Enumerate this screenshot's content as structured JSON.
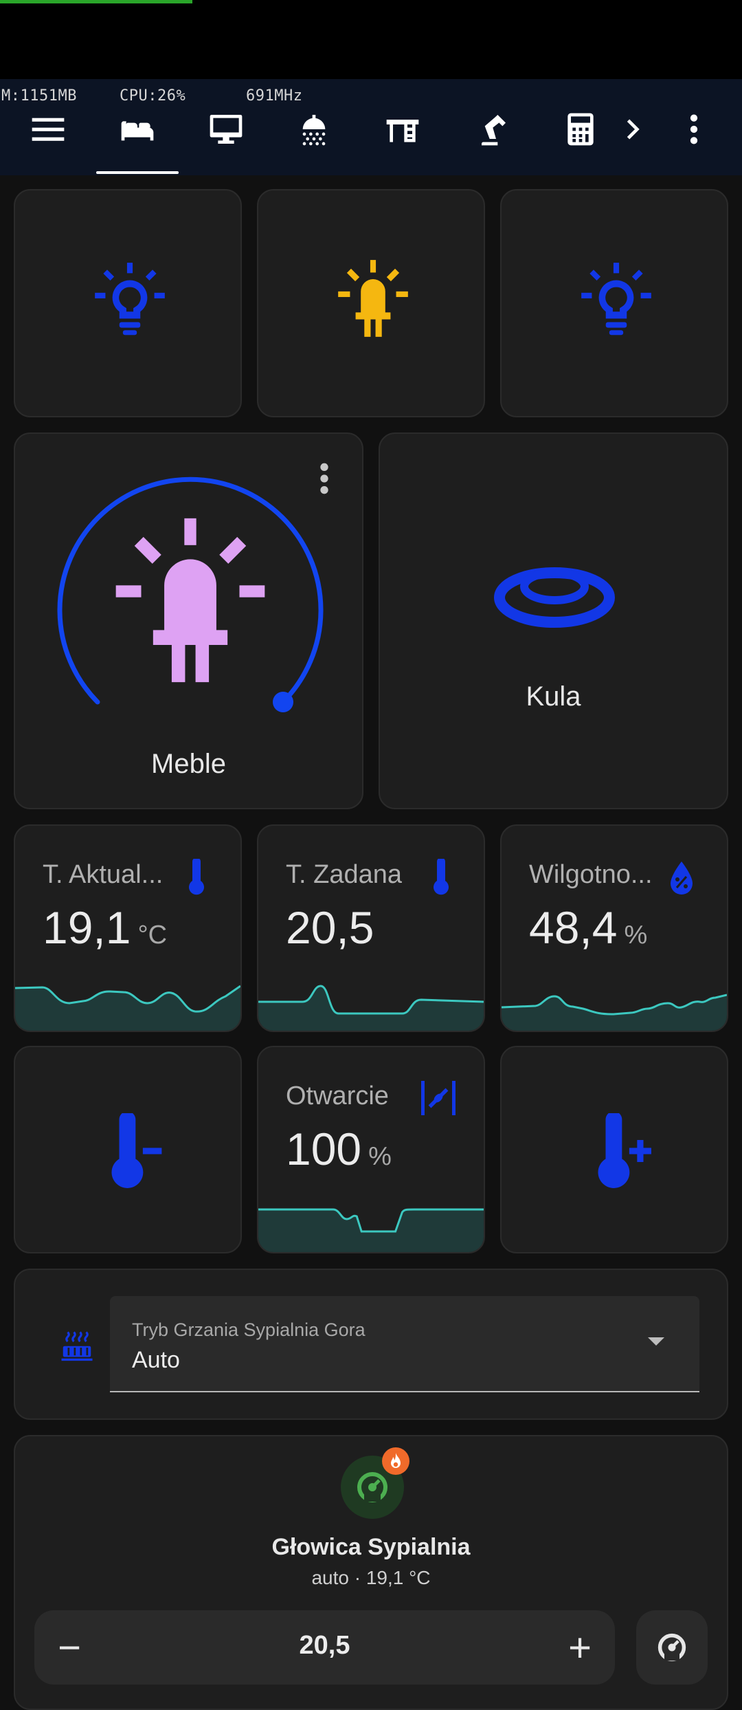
{
  "status": {
    "mem": "M:1151MB",
    "cpu": "CPU:26%",
    "freq": "691MHz"
  },
  "nav": {
    "tabs": [
      {
        "icon": "bed-icon",
        "active": true
      },
      {
        "icon": "monitor-icon",
        "active": false
      },
      {
        "icon": "shower-icon",
        "active": false
      },
      {
        "icon": "desk-icon",
        "active": false
      },
      {
        "icon": "desk-lamp-icon",
        "active": false
      },
      {
        "icon": "calculator-icon",
        "active": false
      }
    ],
    "menu_icon": "menu-icon",
    "more_icon": "chevron-right-icon",
    "overflow_icon": "dots-vertical-icon"
  },
  "lights": [
    {
      "icon": "lightbulb-icon",
      "state": "off",
      "color": "#1237e6"
    },
    {
      "icon": "led-on-icon",
      "state": "on",
      "color": "#f5b710"
    },
    {
      "icon": "lightbulb-icon",
      "state": "off",
      "color": "#1237e6"
    }
  ],
  "meble": {
    "name": "Meble",
    "icon": "led-on-icon",
    "icon_color": "#dea2f3",
    "ring_color": "#1245f0",
    "brightness": 0.85
  },
  "kula": {
    "name": "Kula",
    "icon": "ceiling-light-icon",
    "icon_color": "#1237e6"
  },
  "sensors": [
    {
      "name": "T. Aktual...",
      "value": "19,1",
      "unit": "°C",
      "icon": "thermometer-icon"
    },
    {
      "name": "T. Zadana",
      "value": "20,5",
      "unit": "",
      "icon": "thermometer-icon"
    },
    {
      "name": "Wilgotno...",
      "value": "48,4",
      "unit": "%",
      "icon": "water-percent-icon"
    }
  ],
  "controls": {
    "decrease_icon": "thermometer-minus-icon",
    "increase_icon": "thermometer-plus-icon",
    "valve": {
      "name": "Otwarcie",
      "value": "100",
      "unit": "%",
      "icon": "valve-open-icon"
    }
  },
  "mode": {
    "icon": "radiator-icon",
    "label": "Tryb Grzania Sypialnia Gora",
    "value": "Auto"
  },
  "thermostat": {
    "name": "Głowica Sypialnia",
    "state": "auto · 19,1 °C",
    "target": "20,5",
    "minus": "−",
    "plus": "+",
    "badge_icon": "fire-icon",
    "icon": "thermostat-auto-icon",
    "mode_button_icon": "thermostat-auto-icon"
  },
  "colors": {
    "accent_blue": "#1237e6",
    "sparkline": "#3cc8c0",
    "badge_orange": "#f06a2a",
    "thermo_green": "#4caf50"
  }
}
